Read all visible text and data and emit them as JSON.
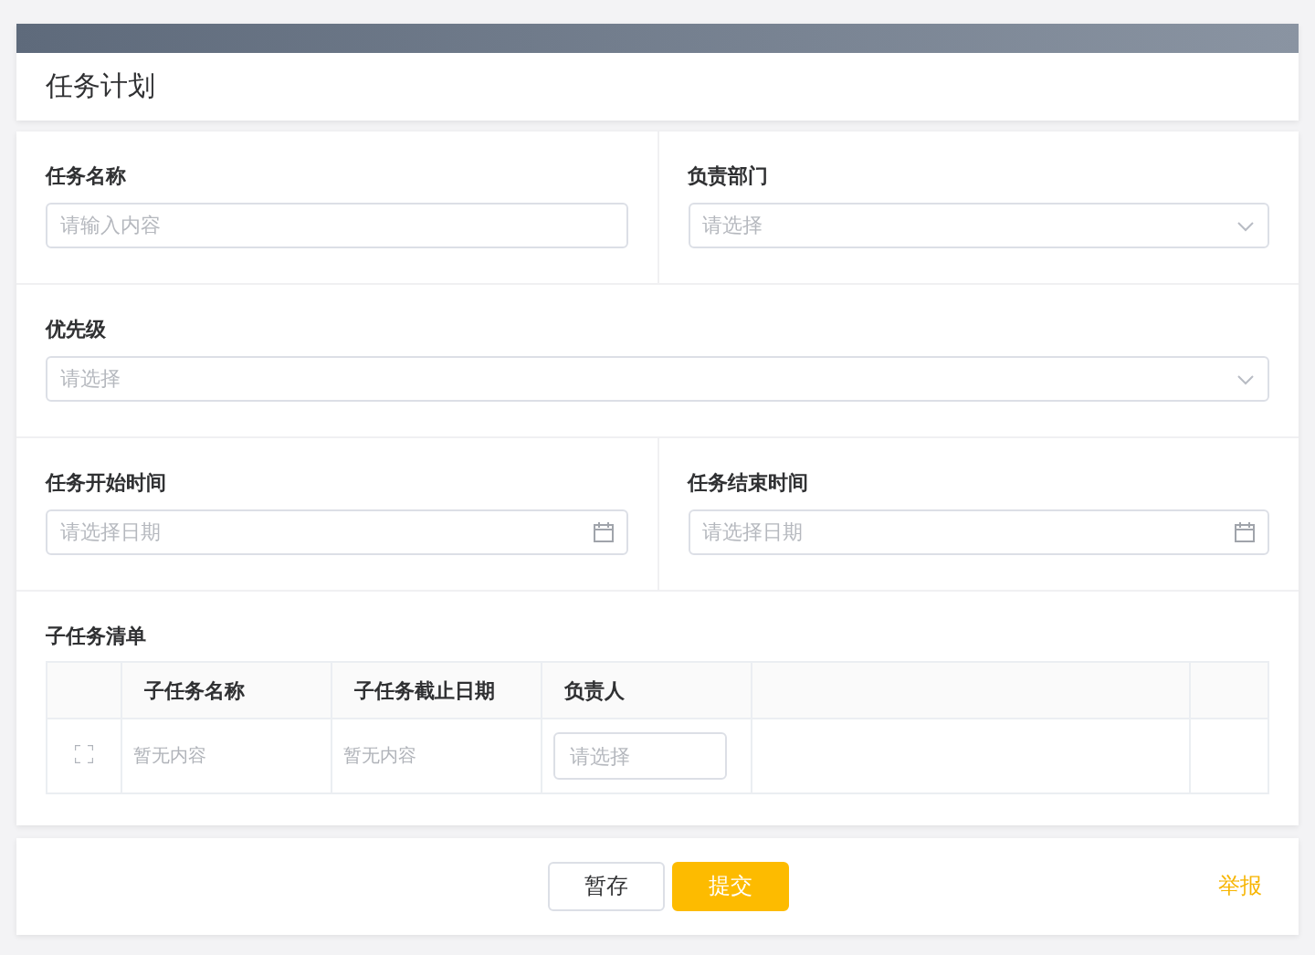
{
  "title": "任务计划",
  "rows": [
    [
      {
        "label": "任务名称",
        "kind": "input",
        "placeholder": "请输入内容"
      },
      {
        "label": "负责部门",
        "kind": "select",
        "placeholder": "请选择"
      }
    ],
    [
      {
        "label": "优先级",
        "kind": "select",
        "placeholder": "请选择"
      }
    ],
    [
      {
        "label": "任务开始时间",
        "kind": "date",
        "placeholder": "请选择日期"
      },
      {
        "label": "任务结束时间",
        "kind": "date",
        "placeholder": "请选择日期"
      }
    ]
  ],
  "subtasks": {
    "title": "子任务清单",
    "columns": [
      "子任务名称",
      "子任务截止日期",
      "负责人"
    ],
    "rows": [
      {
        "name": "暂无内容",
        "deadline": "暂无内容",
        "owner_placeholder": "请选择"
      }
    ]
  },
  "buttons": [
    {
      "label": "暂存",
      "kind": "default"
    },
    {
      "label": "提交",
      "kind": "primary"
    }
  ],
  "report_link": "举报"
}
